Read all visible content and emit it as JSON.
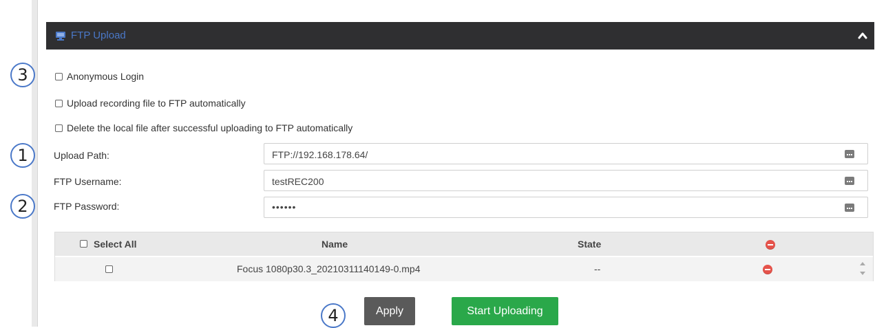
{
  "panel": {
    "title": "FTP Upload",
    "icon": "monitor-icon",
    "collapse_icon": "chevron-up-icon"
  },
  "badges": [
    "3",
    "1",
    "2",
    "4"
  ],
  "options": {
    "anonymous_login": {
      "label": "Anonymous Login",
      "checked": false
    },
    "auto_upload": {
      "label": "Upload recording file to FTP automatically",
      "checked": false
    },
    "delete_local": {
      "label": "Delete the local file after successful uploading to FTP automatically",
      "checked": false
    }
  },
  "fields": {
    "upload_path": {
      "label": "Upload Path:",
      "value": "FTP://192.168.178.64/"
    },
    "username": {
      "label": "FTP Username:",
      "value": "testREC200"
    },
    "password": {
      "label": "FTP Password:",
      "value": "••••••"
    }
  },
  "table": {
    "headers": {
      "select_all": "Select All",
      "name": "Name",
      "state": "State"
    },
    "rows": [
      {
        "name": "Focus 1080p30.3_20210311140149-0.mp4",
        "state": "--",
        "checked": false
      }
    ]
  },
  "buttons": {
    "apply": "Apply",
    "start_uploading": "Start Uploading"
  },
  "colors": {
    "header_bg": "#2f2f31",
    "title_blue": "#4a78c8",
    "apply_bg": "#5a5a5a",
    "upload_bg": "#2aa84a",
    "delete_red": "#e5534b"
  }
}
